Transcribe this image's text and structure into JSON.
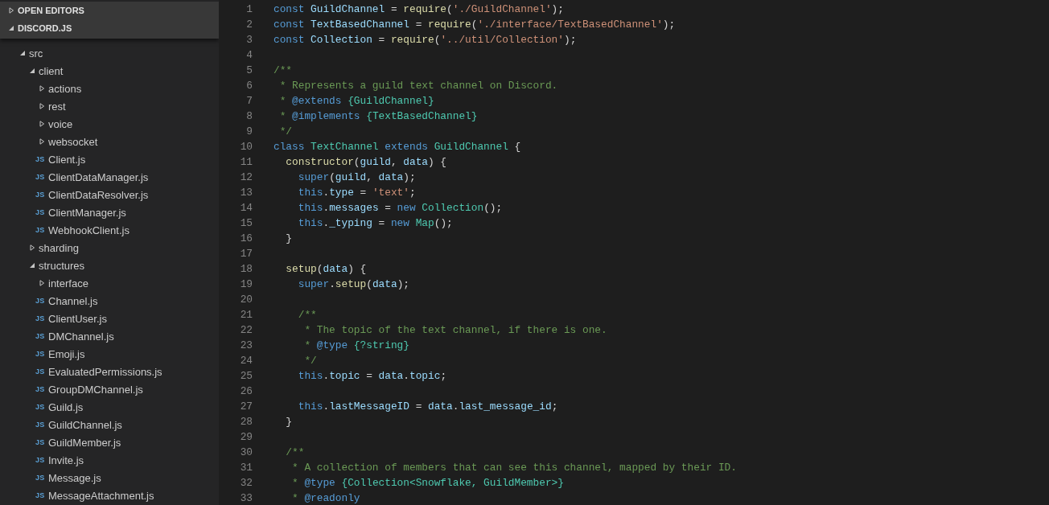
{
  "sidebar": {
    "sections": [
      {
        "title": "OPEN EDITORS",
        "expanded": false
      },
      {
        "title": "DISCORD.JS",
        "expanded": true
      }
    ],
    "tree": [
      {
        "label": "src",
        "kind": "folder",
        "expanded": true,
        "children": [
          {
            "label": "client",
            "kind": "folder",
            "expanded": true,
            "children": [
              {
                "label": "actions",
                "kind": "folder",
                "expanded": false
              },
              {
                "label": "rest",
                "kind": "folder",
                "expanded": false
              },
              {
                "label": "voice",
                "kind": "folder",
                "expanded": false
              },
              {
                "label": "websocket",
                "kind": "folder",
                "expanded": false
              },
              {
                "label": "Client.js",
                "kind": "file",
                "badge": "JS"
              },
              {
                "label": "ClientDataManager.js",
                "kind": "file",
                "badge": "JS"
              },
              {
                "label": "ClientDataResolver.js",
                "kind": "file",
                "badge": "JS"
              },
              {
                "label": "ClientManager.js",
                "kind": "file",
                "badge": "JS"
              },
              {
                "label": "WebhookClient.js",
                "kind": "file",
                "badge": "JS"
              }
            ]
          },
          {
            "label": "sharding",
            "kind": "folder",
            "expanded": false
          },
          {
            "label": "structures",
            "kind": "folder",
            "expanded": true,
            "children": [
              {
                "label": "interface",
                "kind": "folder",
                "expanded": false
              },
              {
                "label": "Channel.js",
                "kind": "file",
                "badge": "JS"
              },
              {
                "label": "ClientUser.js",
                "kind": "file",
                "badge": "JS"
              },
              {
                "label": "DMChannel.js",
                "kind": "file",
                "badge": "JS"
              },
              {
                "label": "Emoji.js",
                "kind": "file",
                "badge": "JS"
              },
              {
                "label": "EvaluatedPermissions.js",
                "kind": "file",
                "badge": "JS"
              },
              {
                "label": "GroupDMChannel.js",
                "kind": "file",
                "badge": "JS"
              },
              {
                "label": "Guild.js",
                "kind": "file",
                "badge": "JS"
              },
              {
                "label": "GuildChannel.js",
                "kind": "file",
                "badge": "JS"
              },
              {
                "label": "GuildMember.js",
                "kind": "file",
                "badge": "JS"
              },
              {
                "label": "Invite.js",
                "kind": "file",
                "badge": "JS"
              },
              {
                "label": "Message.js",
                "kind": "file",
                "badge": "JS"
              },
              {
                "label": "MessageAttachment.js",
                "kind": "file",
                "badge": "JS"
              }
            ]
          }
        ]
      }
    ]
  },
  "editor": {
    "lines": [
      {
        "number": "1",
        "tokens": [
          {
            "kind": "keyword",
            "text": "const "
          },
          {
            "kind": "variable",
            "text": "GuildChannel"
          },
          {
            "kind": "plain",
            "text": " = "
          },
          {
            "kind": "function",
            "text": "require"
          },
          {
            "kind": "plain",
            "text": "("
          },
          {
            "kind": "string",
            "text": "'./GuildChannel'"
          },
          {
            "kind": "plain",
            "text": ");"
          }
        ]
      },
      {
        "number": "2",
        "tokens": [
          {
            "kind": "keyword",
            "text": "const "
          },
          {
            "kind": "variable",
            "text": "TextBasedChannel"
          },
          {
            "kind": "plain",
            "text": " = "
          },
          {
            "kind": "function",
            "text": "require"
          },
          {
            "kind": "plain",
            "text": "("
          },
          {
            "kind": "string",
            "text": "'./interface/TextBasedChannel'"
          },
          {
            "kind": "plain",
            "text": ");"
          }
        ]
      },
      {
        "number": "3",
        "tokens": [
          {
            "kind": "keyword",
            "text": "const "
          },
          {
            "kind": "variable",
            "text": "Collection"
          },
          {
            "kind": "plain",
            "text": " = "
          },
          {
            "kind": "function",
            "text": "require"
          },
          {
            "kind": "plain",
            "text": "("
          },
          {
            "kind": "string",
            "text": "'../util/Collection'"
          },
          {
            "kind": "plain",
            "text": ");"
          }
        ]
      },
      {
        "number": "4"
      },
      {
        "number": "5",
        "tokens": [
          {
            "kind": "comment",
            "text": "/**"
          }
        ]
      },
      {
        "number": "6",
        "tokens": [
          {
            "kind": "comment",
            "text": " * Represents a guild text channel on Discord."
          }
        ]
      },
      {
        "number": "7",
        "tokens": [
          {
            "kind": "comment",
            "text": " * "
          },
          {
            "kind": "doctag",
            "text": "@extends "
          },
          {
            "kind": "type",
            "text": "{GuildChannel}"
          }
        ]
      },
      {
        "number": "8",
        "tokens": [
          {
            "kind": "comment",
            "text": " * "
          },
          {
            "kind": "doctag",
            "text": "@implements "
          },
          {
            "kind": "type",
            "text": "{TextBasedChannel}"
          }
        ]
      },
      {
        "number": "9",
        "tokens": [
          {
            "kind": "comment",
            "text": " */"
          }
        ]
      },
      {
        "number": "10",
        "tokens": [
          {
            "kind": "keyword",
            "text": "class "
          },
          {
            "kind": "type",
            "text": "TextChannel"
          },
          {
            "kind": "keyword",
            "text": " extends "
          },
          {
            "kind": "type",
            "text": "GuildChannel"
          },
          {
            "kind": "plain",
            "text": " {"
          }
        ]
      },
      {
        "number": "11",
        "tokens": [
          {
            "kind": "function",
            "text": "  constructor"
          },
          {
            "kind": "plain",
            "text": "("
          },
          {
            "kind": "variable",
            "text": "guild"
          },
          {
            "kind": "plain",
            "text": ", "
          },
          {
            "kind": "variable",
            "text": "data"
          },
          {
            "kind": "plain",
            "text": ") {"
          }
        ]
      },
      {
        "number": "12",
        "tokens": [
          {
            "kind": "keyword",
            "text": "    super"
          },
          {
            "kind": "plain",
            "text": "("
          },
          {
            "kind": "variable",
            "text": "guild"
          },
          {
            "kind": "plain",
            "text": ", "
          },
          {
            "kind": "variable",
            "text": "data"
          },
          {
            "kind": "plain",
            "text": ");"
          }
        ]
      },
      {
        "number": "13",
        "tokens": [
          {
            "kind": "keyword",
            "text": "    this"
          },
          {
            "kind": "plain",
            "text": "."
          },
          {
            "kind": "variable",
            "text": "type"
          },
          {
            "kind": "plain",
            "text": " = "
          },
          {
            "kind": "string",
            "text": "'text'"
          },
          {
            "kind": "plain",
            "text": ";"
          }
        ]
      },
      {
        "number": "14",
        "tokens": [
          {
            "kind": "keyword",
            "text": "    this"
          },
          {
            "kind": "plain",
            "text": "."
          },
          {
            "kind": "variable",
            "text": "messages"
          },
          {
            "kind": "plain",
            "text": " = "
          },
          {
            "kind": "keyword",
            "text": "new "
          },
          {
            "kind": "type",
            "text": "Collection"
          },
          {
            "kind": "plain",
            "text": "();"
          }
        ]
      },
      {
        "number": "15",
        "tokens": [
          {
            "kind": "keyword",
            "text": "    this"
          },
          {
            "kind": "plain",
            "text": "."
          },
          {
            "kind": "variable",
            "text": "_typing"
          },
          {
            "kind": "plain",
            "text": " = "
          },
          {
            "kind": "keyword",
            "text": "new "
          },
          {
            "kind": "type",
            "text": "Map"
          },
          {
            "kind": "plain",
            "text": "();"
          }
        ]
      },
      {
        "number": "16",
        "tokens": [
          {
            "kind": "plain",
            "text": "  }"
          }
        ]
      },
      {
        "number": "17"
      },
      {
        "number": "18",
        "tokens": [
          {
            "kind": "function",
            "text": "  setup"
          },
          {
            "kind": "plain",
            "text": "("
          },
          {
            "kind": "variable",
            "text": "data"
          },
          {
            "kind": "plain",
            "text": ") {"
          }
        ]
      },
      {
        "number": "19",
        "tokens": [
          {
            "kind": "keyword",
            "text": "    super"
          },
          {
            "kind": "plain",
            "text": "."
          },
          {
            "kind": "function",
            "text": "setup"
          },
          {
            "kind": "plain",
            "text": "("
          },
          {
            "kind": "variable",
            "text": "data"
          },
          {
            "kind": "plain",
            "text": ");"
          }
        ]
      },
      {
        "number": "20"
      },
      {
        "number": "21",
        "tokens": [
          {
            "kind": "comment",
            "text": "    /**"
          }
        ]
      },
      {
        "number": "22",
        "tokens": [
          {
            "kind": "comment",
            "text": "     * The topic of the text channel, if there is one."
          }
        ]
      },
      {
        "number": "23",
        "tokens": [
          {
            "kind": "comment",
            "text": "     * "
          },
          {
            "kind": "doctag",
            "text": "@type "
          },
          {
            "kind": "type",
            "text": "{?string}"
          }
        ]
      },
      {
        "number": "24",
        "tokens": [
          {
            "kind": "comment",
            "text": "     */"
          }
        ]
      },
      {
        "number": "25",
        "tokens": [
          {
            "kind": "keyword",
            "text": "    this"
          },
          {
            "kind": "plain",
            "text": "."
          },
          {
            "kind": "variable",
            "text": "topic"
          },
          {
            "kind": "plain",
            "text": " = "
          },
          {
            "kind": "variable",
            "text": "data"
          },
          {
            "kind": "plain",
            "text": "."
          },
          {
            "kind": "variable",
            "text": "topic"
          },
          {
            "kind": "plain",
            "text": ";"
          }
        ]
      },
      {
        "number": "26"
      },
      {
        "number": "27",
        "tokens": [
          {
            "kind": "keyword",
            "text": "    this"
          },
          {
            "kind": "plain",
            "text": "."
          },
          {
            "kind": "variable",
            "text": "lastMessageID"
          },
          {
            "kind": "plain",
            "text": " = "
          },
          {
            "kind": "variable",
            "text": "data"
          },
          {
            "kind": "plain",
            "text": "."
          },
          {
            "kind": "variable",
            "text": "last_message_id"
          },
          {
            "kind": "plain",
            "text": ";"
          }
        ]
      },
      {
        "number": "28",
        "tokens": [
          {
            "kind": "plain",
            "text": "  }"
          }
        ]
      },
      {
        "number": "29"
      },
      {
        "number": "30",
        "tokens": [
          {
            "kind": "comment",
            "text": "  /**"
          }
        ]
      },
      {
        "number": "31",
        "tokens": [
          {
            "kind": "comment",
            "text": "   * A collection of members that can see this channel, mapped by their ID."
          }
        ]
      },
      {
        "number": "32",
        "tokens": [
          {
            "kind": "comment",
            "text": "   * "
          },
          {
            "kind": "doctag",
            "text": "@type "
          },
          {
            "kind": "type",
            "text": "{Collection<Snowflake, GuildMember>}"
          }
        ]
      },
      {
        "number": "33",
        "tokens": [
          {
            "kind": "comment",
            "text": "   * "
          },
          {
            "kind": "doctag",
            "text": "@readonly"
          }
        ]
      }
    ]
  }
}
